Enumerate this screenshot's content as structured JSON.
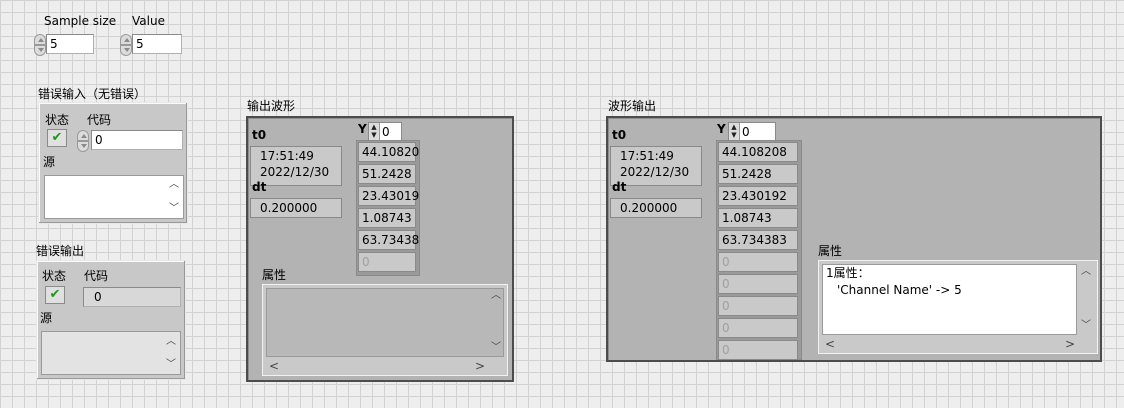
{
  "controls": {
    "sample_size": {
      "label": "Sample size",
      "value": "5"
    },
    "value": {
      "label": "Value",
      "value": "5"
    }
  },
  "error_in": {
    "title": "错误输入（无错误）",
    "status_label": "状态",
    "code_label": "代码",
    "code_value": "0",
    "source_label": "源",
    "status_value": "✔"
  },
  "error_out": {
    "title": "错误输出",
    "status_label": "状态",
    "code_label": "代码",
    "code_value": "0",
    "source_label": "源",
    "status_value": "✔"
  },
  "waveform_out": {
    "title": "输出波形",
    "t0_label": "t0",
    "time": "17:51:49",
    "date": "2022/12/30",
    "dt_label": "dt",
    "dt_value": "0.200000",
    "y_label": "Y",
    "y_index": "0",
    "y_values": [
      "44.10820",
      "51.2428",
      "23.43019",
      "1.08743",
      "63.73438",
      "0"
    ],
    "attr_label": "属性"
  },
  "waveform_out2": {
    "title": "波形输出",
    "t0_label": "t0",
    "time": "17:51:49",
    "date": "2022/12/30",
    "dt_label": "dt",
    "dt_value": "0.200000",
    "y_label": "Y",
    "y_index": "0",
    "y_values": [
      "44.108208",
      "51.2428",
      "23.430192",
      "1.08743",
      "63.734383",
      "0",
      "0",
      "0",
      "0",
      "0"
    ],
    "attr_label": "属性",
    "attr_text_line1": "1属性：",
    "attr_text_line2": "'Channel Name' -> 5"
  },
  "icons": {
    "up": "▲",
    "down": "▼",
    "left": "<",
    "right": ">",
    "check": "checkmark-icon"
  }
}
